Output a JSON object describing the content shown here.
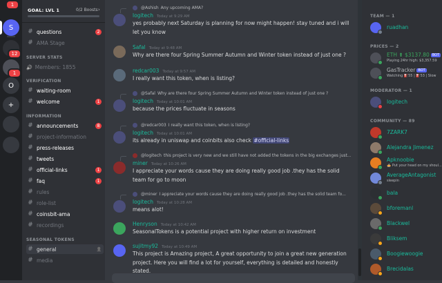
{
  "guild_bar": {
    "top_badge": "1",
    "items": [
      {
        "label": "S",
        "color": "#5865f2"
      },
      {
        "label": "",
        "color": "#2f3136",
        "badge": "12"
      },
      {
        "label": "",
        "color": "#4e5058",
        "badge": "1"
      },
      {
        "label": "O",
        "color": "#36393f"
      },
      {
        "label": "+",
        "color": "#36393f"
      },
      {
        "label": "",
        "color": "#36393f"
      },
      {
        "label": "",
        "color": "#36393f"
      }
    ]
  },
  "channels": {
    "goal": "GOAL: LVL 1",
    "boosts": "0/2 Boosts",
    "items": [
      {
        "label": "questions",
        "unread": true,
        "badge": "2"
      },
      {
        "label": "AMA Stage",
        "muted": true
      },
      {
        "category": "SERVER STATS"
      },
      {
        "stat": "Members: 1855"
      },
      {
        "category": "VERIFICATION"
      },
      {
        "label": "waiting-room",
        "unread": true
      },
      {
        "label": "welcome",
        "unread": true,
        "badge": "1"
      },
      {
        "category": "INFORMATION"
      },
      {
        "label": "announcements",
        "unread": true,
        "badge": "8"
      },
      {
        "label": "project-information",
        "muted": true
      },
      {
        "label": "press-releases",
        "unread": true
      },
      {
        "label": "tweets",
        "unread": true
      },
      {
        "label": "official-links",
        "unread": true,
        "badge": "1"
      },
      {
        "label": "faq",
        "unread": true,
        "badge": "1"
      },
      {
        "label": "rules",
        "muted": true
      },
      {
        "label": "role-list",
        "muted": true
      },
      {
        "label": "coinsbit-ama",
        "unread": true
      },
      {
        "label": "recordings",
        "muted": true
      },
      {
        "category": "SEASONAL TOKENS"
      },
      {
        "label": "general",
        "selected": true
      },
      {
        "label": "media",
        "muted": true
      }
    ]
  },
  "messages": [
    {
      "reply_user": "@Ashish",
      "reply_text": "Any upcoming AMA?",
      "user": "logitech",
      "color": "#1abc9c",
      "time": "Today at 9:29 AM",
      "text": "yes probably next Saturday is planning for now might happen! stay tuned and i will let you know",
      "avatar_color": "#4b4e7a"
    },
    {
      "user": "Safal",
      "color": "#1abc9c",
      "time": "Today at 9:48 AM",
      "text": "Why are there four Spring Summer Autumn and Winter token instead of just one ?",
      "avatar_color": "#7a6a5a"
    },
    {
      "user": "redcar003",
      "color": "#1abc9c",
      "time": "Today at 9:57 AM",
      "text": "I really want this token, when is listing?",
      "avatar_color": "#5a6a7a"
    },
    {
      "reply_user": "@Safal",
      "reply_text": "Why are there four Spring Summer Autumn and Winter token instead of just one ?",
      "user": "logitech",
      "color": "#1abc9c",
      "time": "Today at 10:01 AM",
      "text": "because the prices fluctuate in seasons",
      "avatar_color": "#4b4e7a"
    },
    {
      "reply_user": "@redcar003",
      "reply_text": "I really want this token, when is listing?",
      "user": "logitech",
      "color": "#1abc9c",
      "time": "Today at 10:01 AM",
      "text_before": "its already in uniswap and coinbits also check ",
      "mention": "#official-links",
      "avatar_color": "#4b4e7a"
    },
    {
      "reply_user": "@logitech",
      "reply_text": "this project is very new and we still have not added the tokens in the big exchanges just...",
      "user": "miner",
      "color": "#1abc9c",
      "time": "Today at 10:26 AM",
      "text": "I appreciate your words cause they are doing really good job .they has the solid team for go to moon",
      "avatar_color": "#8a2b2b"
    },
    {
      "reply_user": "@miner",
      "reply_text": "I appreciate your words cause they are doing really good job .they has the solid team fo...",
      "user": "logitech",
      "color": "#1abc9c",
      "time": "Today at 10:28 AM",
      "text": "means alot!",
      "avatar_color": "#4b4e7a"
    },
    {
      "user": "Henryson",
      "color": "#1abc9c",
      "time": "Today at 10:42 AM",
      "text": "SeasonalTokens is a potential project with higher return on investment",
      "avatar_color": "#3ba55d"
    },
    {
      "user": "sujitmy92",
      "color": "#1abc9c",
      "time": "Today at 10:49 AM",
      "text": "This project is Amazing project, A great opportunity to join a great new generation project. Here you will find a lot for yourself, everything is detailed and honestly stated.",
      "avatar_color": "#5865f2"
    }
  ],
  "members": {
    "groups": [
      {
        "title": "TEAM — 1",
        "items": [
          {
            "name": "ruadhan",
            "color": "#1abc9c",
            "avatar_color": "#5865f2",
            "status": "#747f8d"
          }
        ]
      },
      {
        "title": "PRICES — 2",
        "items": [
          {
            "name": "ETH ⬆ $3137.80",
            "tag": "BOT",
            "sub": "Playing 24hr high: $3,357.59",
            "color": "#3ba55d",
            "avatar_color": "#4e5058",
            "status": "#3ba55d"
          },
          {
            "name": "GasTracker",
            "tag": "BOT",
            "sub": "Watching ⛽55 | ⛽53 | Slow",
            "color": "#b9bbbe",
            "avatar_color": "#4e5058",
            "status": "#3ba55d"
          }
        ]
      },
      {
        "title": "MODERATOR — 1",
        "items": [
          {
            "name": "logitech",
            "color": "#1abc9c",
            "avatar_color": "#4b4e7a",
            "status": "#ed4245"
          }
        ]
      },
      {
        "title": "COMMUNITY — 89",
        "items": [
          {
            "name": "7ZARK7",
            "color": "#1abc9c",
            "avatar_color": "#c0392b",
            "status": "#3ba55d"
          },
          {
            "name": "Alejandra Jimenez",
            "color": "#1abc9c",
            "avatar_color": "#8e7a6a",
            "status": "#3ba55d"
          },
          {
            "name": "Apknoobie",
            "sub": "🥧 Put your head on my shoul...",
            "color": "#1abc9c",
            "avatar_color": "#e67e22",
            "status": "#3ba55d"
          },
          {
            "name": "AverageAntagonist",
            "sub": "sleepin",
            "color": "#1abc9c",
            "avatar_color": "#7289da",
            "status": "#747f8d"
          },
          {
            "name": "bala",
            "color": "#1abc9c",
            "avatar_color": "#2c2f33",
            "status": "#3ba55d"
          },
          {
            "name": "bforemanl",
            "color": "#1abc9c",
            "avatar_color": "#5b4a3a",
            "status": "#faa61a"
          },
          {
            "name": "Blackwel",
            "color": "#1abc9c",
            "avatar_color": "#6a6a6a",
            "status": "#3ba55d"
          },
          {
            "name": "Bliksem",
            "color": "#1abc9c",
            "avatar_color": "#3a3a3a",
            "status": "#faa61a"
          },
          {
            "name": "Boogiewoogie",
            "color": "#1abc9c",
            "avatar_color": "#4a5a6a",
            "status": "#faa61a"
          },
          {
            "name": "Brecidalas",
            "color": "#1abc9c",
            "avatar_color": "#b05a2a",
            "status": "#faa61a"
          }
        ]
      }
    ]
  }
}
